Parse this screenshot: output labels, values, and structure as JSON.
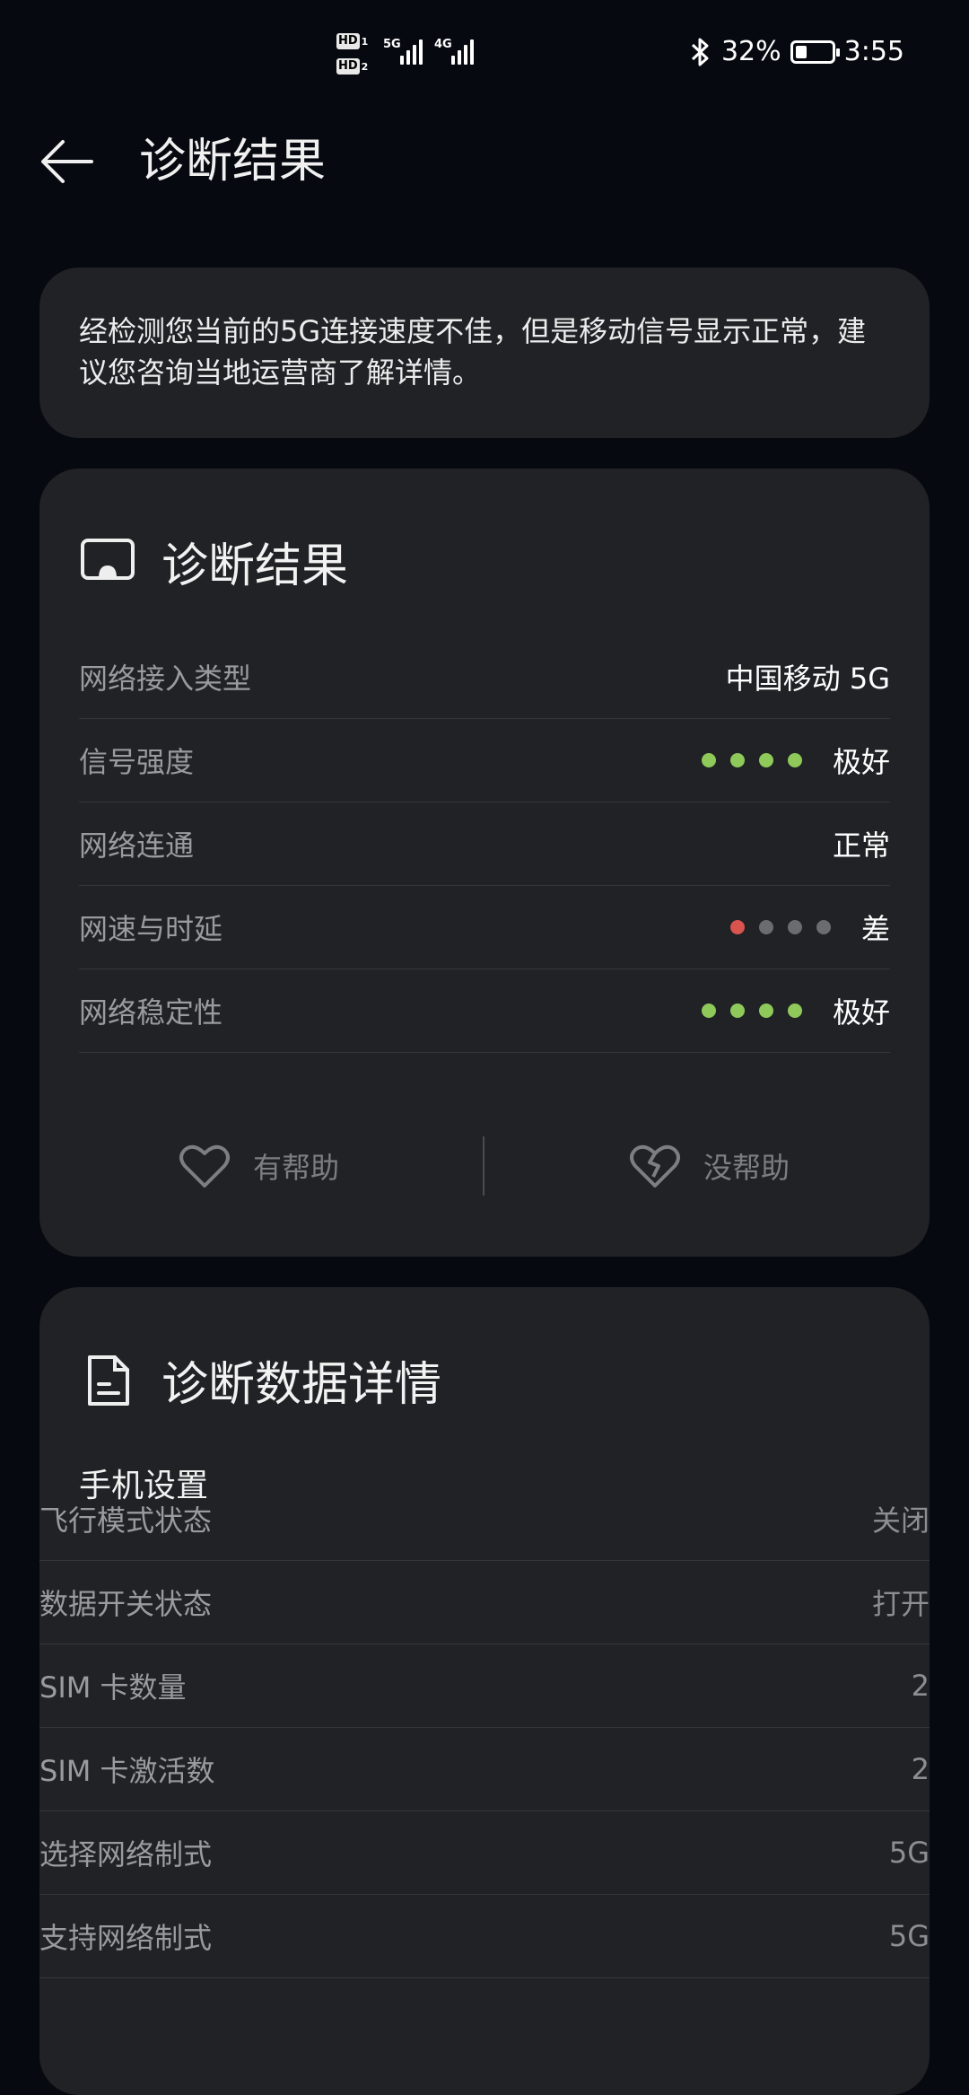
{
  "status_bar": {
    "sim1_label": "HD",
    "sim1_num": "1",
    "sim2_label": "HD",
    "sim2_num": "2",
    "net1": "5G",
    "net2": "4G",
    "battery_pct": "32%",
    "battery_level": 0.32,
    "time": "3:55",
    "icons": [
      "bluetooth-icon",
      "battery-icon",
      "signal-icon"
    ]
  },
  "header": {
    "back_icon": "back-arrow-icon",
    "title": "诊断结果"
  },
  "notice": {
    "text": "经检测您当前的5G连接速度不佳，但是移动信号显示正常，建议您咨询当地运营商了解详情。"
  },
  "result_card": {
    "icon": "cast-screen-icon",
    "title": "诊断结果",
    "rows": [
      {
        "label": "网络接入类型",
        "value": "中国移动 5G"
      },
      {
        "label": "信号强度",
        "value": "极好",
        "dots": [
          "#8fc95a",
          "#8fc95a",
          "#8fc95a",
          "#8fc95a"
        ]
      },
      {
        "label": "网络连通",
        "value": "正常"
      },
      {
        "label": "网速与时延",
        "value": "差",
        "dots": [
          "#d9534f",
          "#6b6c70",
          "#6b6c70",
          "#6b6c70"
        ]
      },
      {
        "label": "网络稳定性",
        "value": "极好",
        "dots": [
          "#8fc95a",
          "#8fc95a",
          "#8fc95a",
          "#8fc95a"
        ]
      }
    ],
    "helpful_label": "有帮助",
    "not_helpful_label": "没帮助"
  },
  "data_card": {
    "icon": "document-icon",
    "title": "诊断数据详情",
    "section_title": "手机设置",
    "rows": [
      {
        "label": "飞行模式状态",
        "value": "关闭"
      },
      {
        "label": "数据开关状态",
        "value": "打开"
      },
      {
        "label": "SIM 卡数量",
        "value": "2"
      },
      {
        "label": "SIM 卡激活数",
        "value": "2"
      },
      {
        "label": "选择网络制式",
        "value": "5G"
      },
      {
        "label": "支持网络制式",
        "value": "5G"
      }
    ]
  },
  "colors": {
    "background": "#070910",
    "card": "#212225",
    "good": "#8fc95a",
    "bad": "#d9534f",
    "inactive": "#6b6c70"
  }
}
